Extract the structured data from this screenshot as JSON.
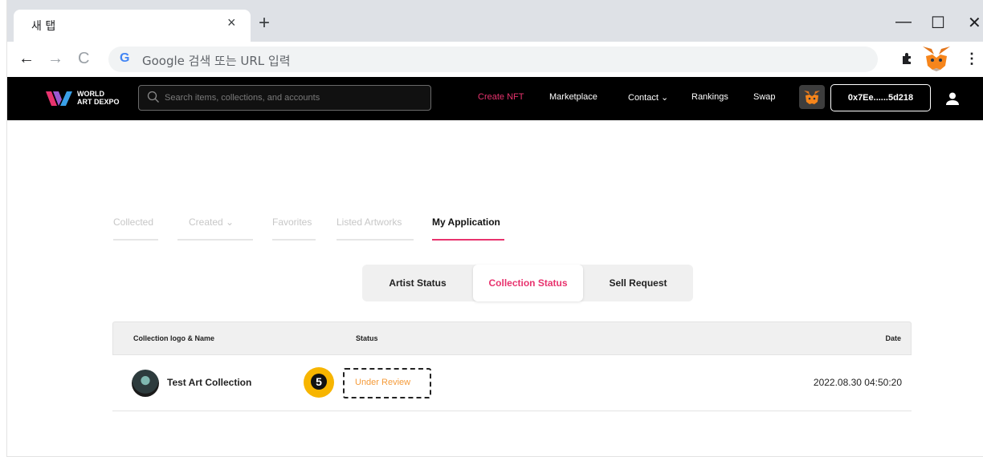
{
  "browser": {
    "tab_title": "새 탭",
    "tab_close": "×",
    "new_tab": "+",
    "omnibox_placeholder": "Google 검색 또는 URL 입력",
    "nav_back": "←",
    "nav_forward": "→",
    "nav_reload": "C",
    "google_g": "G",
    "window_minimize": "—",
    "window_maximize": "☐",
    "window_close": "✕",
    "menu_dots": "⋮"
  },
  "site": {
    "logo_line1": "WORLD",
    "logo_line2": "ART DEXPO",
    "search_placeholder": "Search items, collections, and accounts",
    "nav": {
      "create_nft": "Create NFT",
      "marketplace": "Marketplace",
      "contact": "Contact ⌄",
      "rankings": "Rankings",
      "swap": "Swap"
    },
    "wallet_address": "0x7Ee......5d218"
  },
  "profile_tabs": [
    {
      "label": "Collected"
    },
    {
      "label": "Created ⌄"
    },
    {
      "label": "Favorites"
    },
    {
      "label": "Listed Artworks"
    },
    {
      "label": "My Application"
    }
  ],
  "segments": {
    "artist_status": "Artist Status",
    "collection_status": "Collection Status",
    "sell_request": "Sell Request"
  },
  "table": {
    "headers": {
      "name": "Collection logo & Name",
      "status": "Status",
      "date": "Date"
    },
    "rows": [
      {
        "name": "Test Art Collection",
        "status": "Under Review",
        "date": "2022.08.30 04:50:20"
      }
    ]
  },
  "annotation": {
    "step": "5"
  },
  "colors": {
    "accent": "#e8336e",
    "status_pending": "#f59b3a",
    "badge": "#f7b500"
  }
}
